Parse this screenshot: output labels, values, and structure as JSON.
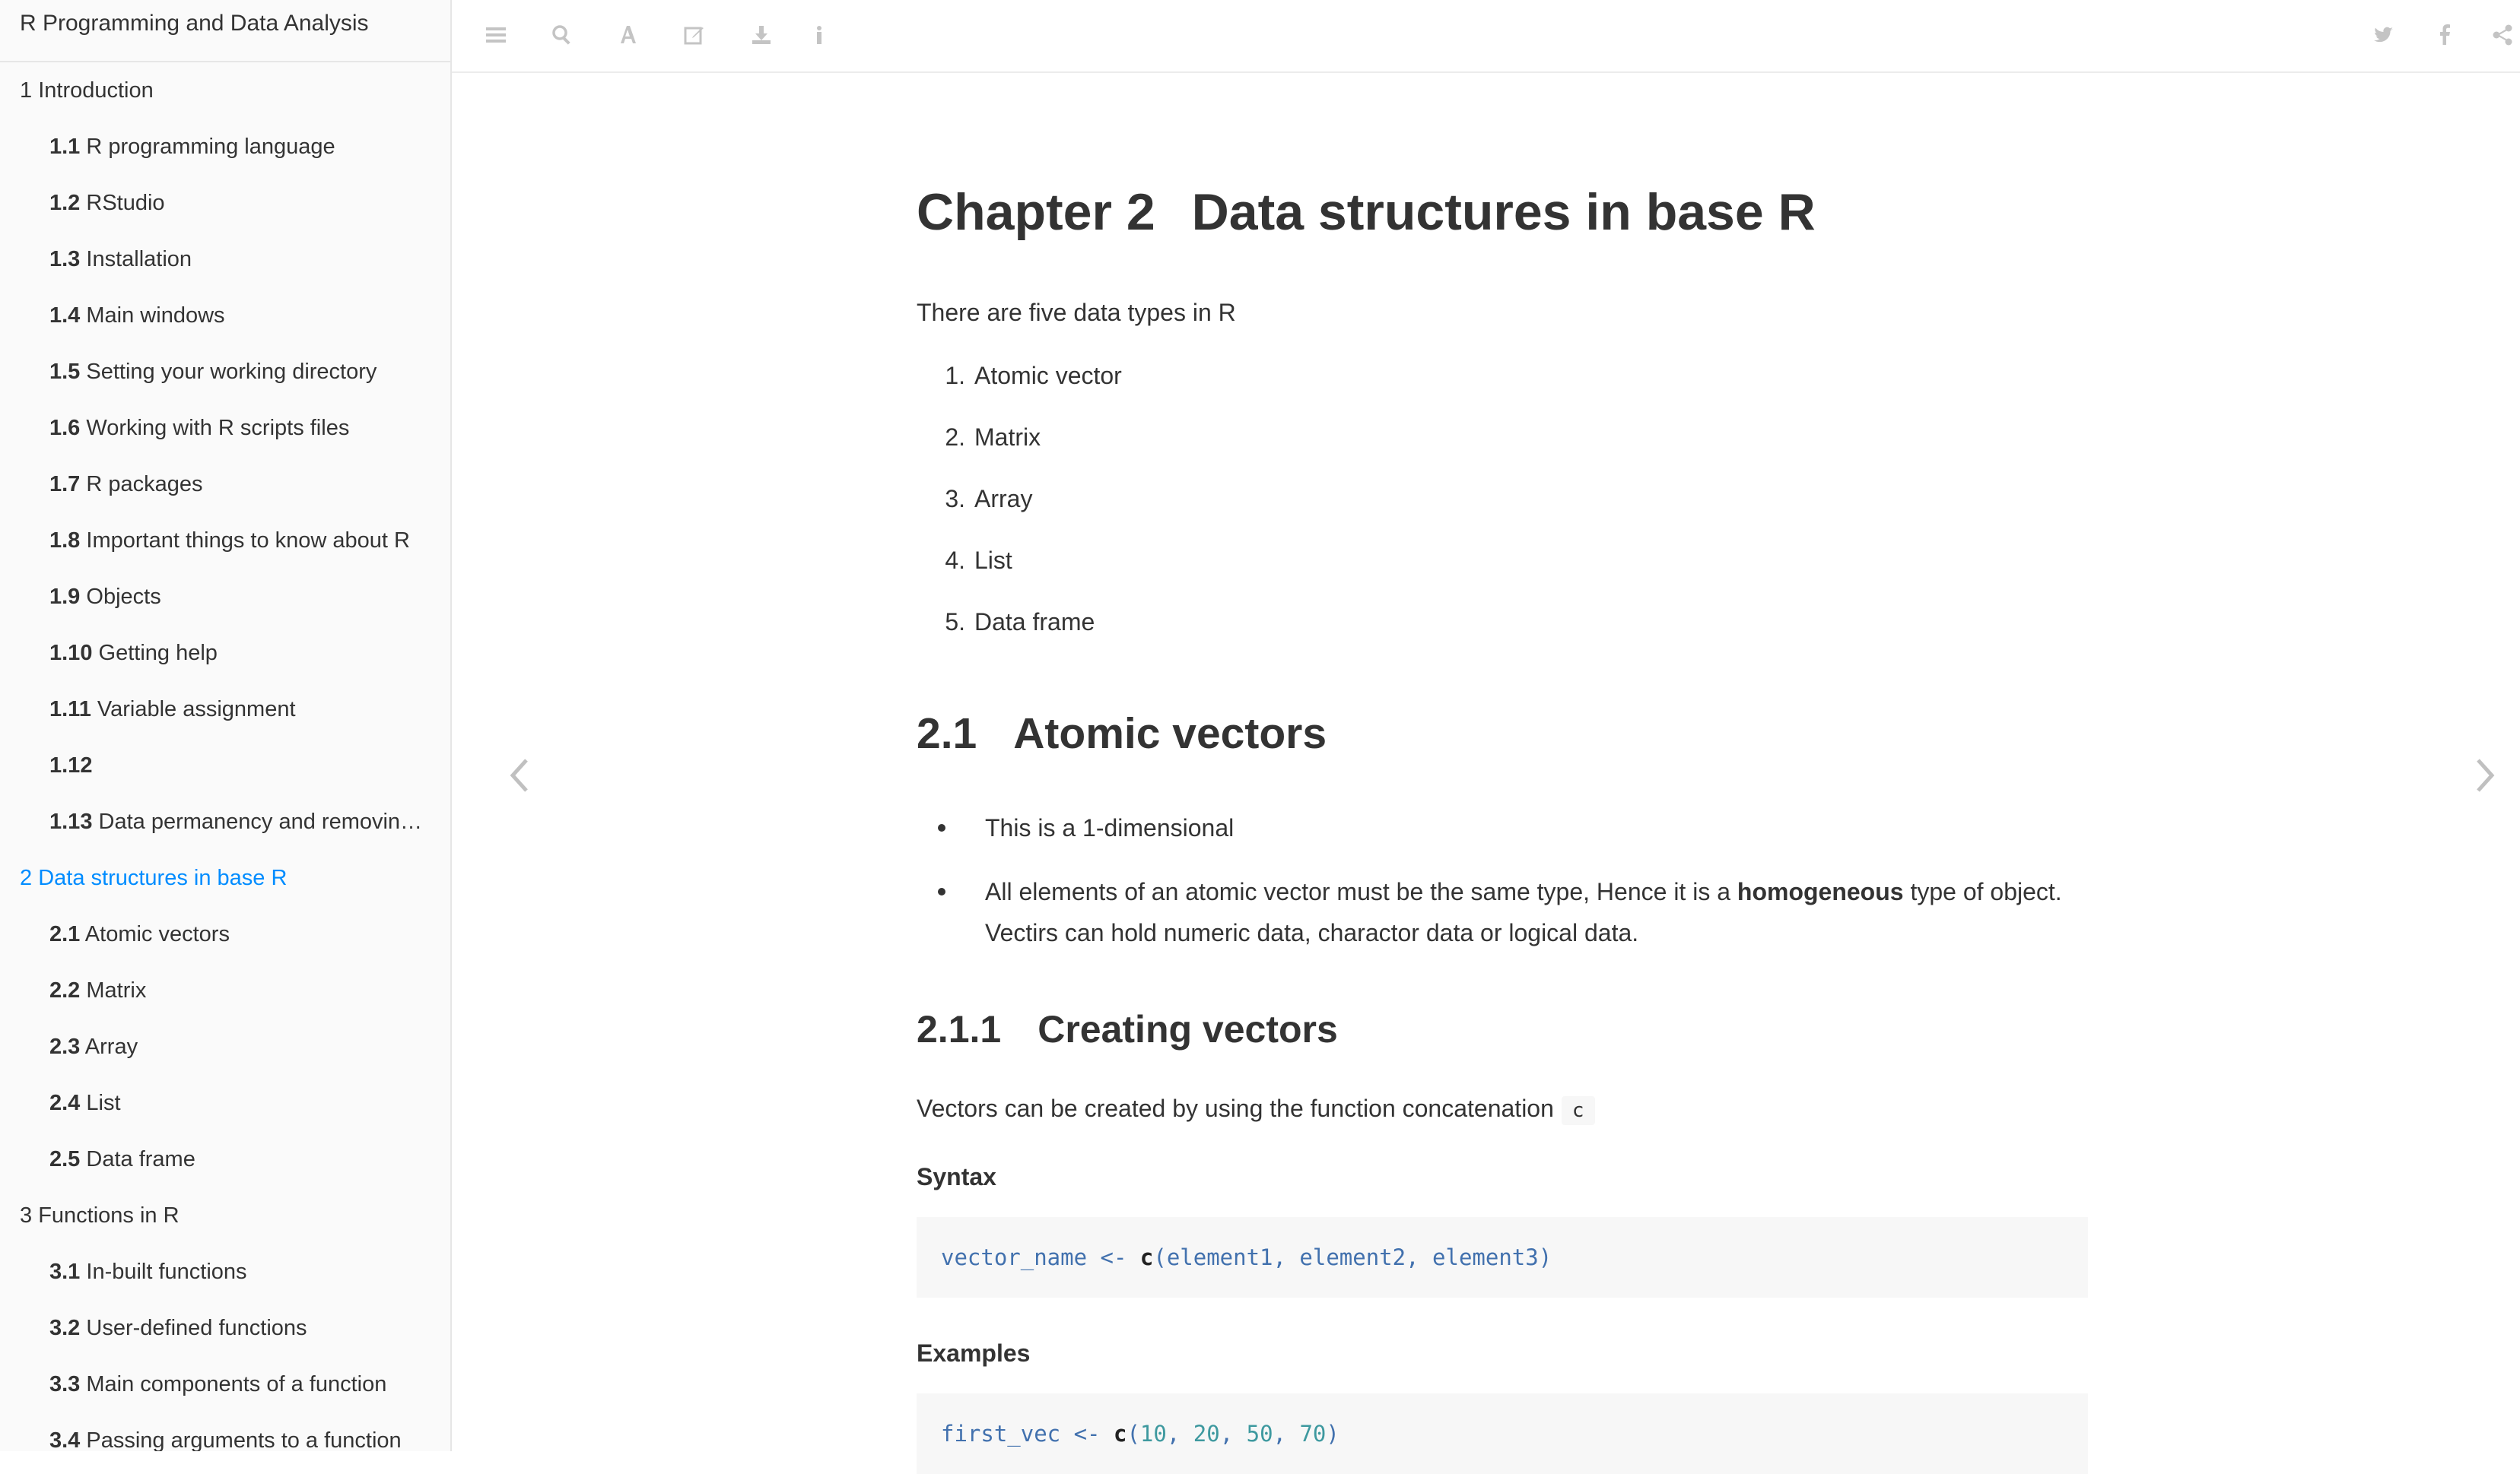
{
  "sidebar": {
    "book_title": "R Programming and Data Analysis",
    "items": [
      {
        "num": "1",
        "label": "Introduction",
        "level": "chapter"
      },
      {
        "num": "1.1",
        "label": "R programming language",
        "level": "section"
      },
      {
        "num": "1.2",
        "label": "RStudio",
        "level": "section"
      },
      {
        "num": "1.3",
        "label": "Installation",
        "level": "section"
      },
      {
        "num": "1.4",
        "label": "Main windows",
        "level": "section"
      },
      {
        "num": "1.5",
        "label": "Setting your working directory",
        "level": "section"
      },
      {
        "num": "1.6",
        "label": "Working with R scripts files",
        "level": "section"
      },
      {
        "num": "1.7",
        "label": "R packages",
        "level": "section"
      },
      {
        "num": "1.8",
        "label": "Important things to know about R",
        "level": "section"
      },
      {
        "num": "1.9",
        "label": "Objects",
        "level": "section"
      },
      {
        "num": "1.10",
        "label": "Getting help",
        "level": "section"
      },
      {
        "num": "1.11",
        "label": "Variable assignment",
        "level": "section"
      },
      {
        "num": "1.12",
        "label": "",
        "level": "section"
      },
      {
        "num": "1.13",
        "label": "Data permanency and removin…",
        "level": "section"
      },
      {
        "num": "2",
        "label": "Data structures in base R",
        "level": "chapter",
        "active": true
      },
      {
        "num": "2.1",
        "label": "Atomic vectors",
        "level": "section"
      },
      {
        "num": "2.2",
        "label": "Matrix",
        "level": "section"
      },
      {
        "num": "2.3",
        "label": "Array",
        "level": "section"
      },
      {
        "num": "2.4",
        "label": "List",
        "level": "section"
      },
      {
        "num": "2.5",
        "label": "Data frame",
        "level": "section"
      },
      {
        "num": "3",
        "label": "Functions in R",
        "level": "chapter"
      },
      {
        "num": "3.1",
        "label": "In-built functions",
        "level": "section"
      },
      {
        "num": "3.2",
        "label": "User-defined functions",
        "level": "section"
      },
      {
        "num": "3.3",
        "label": "Main components of a function",
        "level": "section"
      },
      {
        "num": "3.4",
        "label": "Passing arguments to a function",
        "level": "section"
      }
    ]
  },
  "toolbar": {
    "icons": [
      "menu-icon",
      "search-icon",
      "font-icon",
      "edit-icon",
      "download-icon",
      "info-icon",
      "twitter-icon",
      "facebook-icon",
      "share-icon"
    ]
  },
  "content": {
    "chapter_label": "Chapter 2",
    "chapter_title": "Data structures in base R",
    "intro": "There are five data types in R",
    "data_types": [
      "Atomic vector",
      "Matrix",
      "Array",
      "List",
      "Data frame"
    ],
    "section_num": "2.1",
    "section_title": "Atomic vectors",
    "bullet1": "This is a 1-dimensional",
    "bullet2_pre": "All elements of an atomic vector must be the same type, Hence it is a ",
    "bullet2_bold": "homogeneous",
    "bullet2_post": " type of object.",
    "bullet2_line2": "Vectirs can hold numeric data, charactor data or logical data.",
    "subsection_num": "2.1.1",
    "subsection_title": "Creating vectors",
    "creating_text": "Vectors can be created by using the function concatenation",
    "inline_code": "c",
    "syntax_label": "Syntax",
    "syntax_code": {
      "lhs": "vector_name",
      "assign": " <- ",
      "fn": "c",
      "args": "(element1, element2, element3)"
    },
    "examples_label": "Examples",
    "example_code": {
      "lhs": "first_vec",
      "assign": " <- ",
      "fn": "c",
      "open": "(",
      "values": [
        "10",
        "20",
        "50",
        "70"
      ],
      "close": ")"
    }
  },
  "colors": {
    "accent": "#008cff",
    "text": "#333333",
    "sidebar_bg": "#fafafa",
    "code_bg": "#f7f7f7"
  }
}
